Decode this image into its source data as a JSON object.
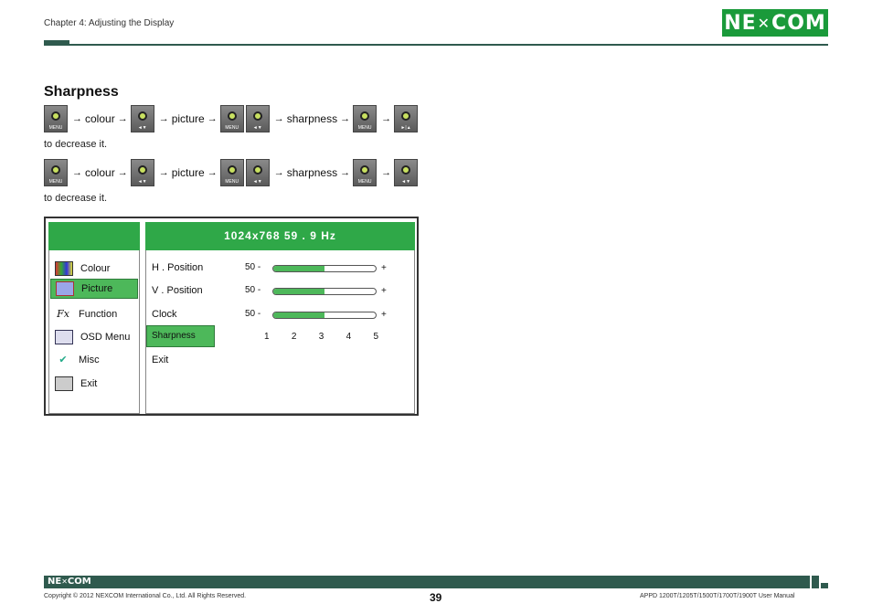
{
  "header": {
    "chapter": "Chapter 4: Adjusting the Display",
    "logo": "NE COM"
  },
  "section": {
    "title": "Sharpness"
  },
  "key_rows": [
    {
      "labels": [
        "colour",
        "picture",
        "sharpness"
      ],
      "key_captions": [
        "MENU",
        "◄▼",
        "MENU",
        "◄▼",
        "MENU",
        "►|▲"
      ]
    },
    {
      "labels": [
        "colour",
        "picture",
        "sharpness"
      ],
      "key_captions": [
        "MENU",
        "◄▼",
        "MENU",
        "◄▼",
        "MENU",
        "◄▼"
      ]
    }
  ],
  "notes": [
    "to decrease it.",
    "to decrease it."
  ],
  "osd": {
    "resolution": "1024x768  59  . 9 Hz",
    "menu": [
      {
        "label": "Colour",
        "icon": "colour-bars-icon",
        "selected": false
      },
      {
        "label": "Picture",
        "icon": "picture-icon",
        "selected": true
      },
      {
        "label": "Function",
        "icon": "function-icon",
        "selected": false
      },
      {
        "label": "OSD Menu",
        "icon": "osd-menu-icon",
        "selected": false
      },
      {
        "label": "Misc",
        "icon": "misc-icon",
        "selected": false
      },
      {
        "label": "Exit",
        "icon": "exit-icon",
        "selected": false
      }
    ],
    "rows": [
      {
        "label": "H . Position",
        "value": "50 -",
        "level": 0.5,
        "plus": "+"
      },
      {
        "label": "V . Position",
        "value": "50 -",
        "level": 0.5,
        "plus": "+"
      },
      {
        "label": "Clock",
        "value": "50 -",
        "level": 0.5,
        "plus": "+"
      },
      {
        "label": "Sharpness",
        "selected": true
      },
      {
        "label": "Exit"
      }
    ],
    "sharpness_scale": [
      "1",
      "2",
      "3",
      "4",
      "5"
    ]
  },
  "footer": {
    "logo": "NE COM",
    "copyright": "Copyright © 2012 NEXCOM International Co., Ltd. All Rights Reserved.",
    "page": "39",
    "manual": "APPD 1200T/1205T/1500T/1700T/1900T User Manual"
  },
  "colors": {
    "accent_green": "#2fa848",
    "brand_dark": "#2f5a4e"
  }
}
